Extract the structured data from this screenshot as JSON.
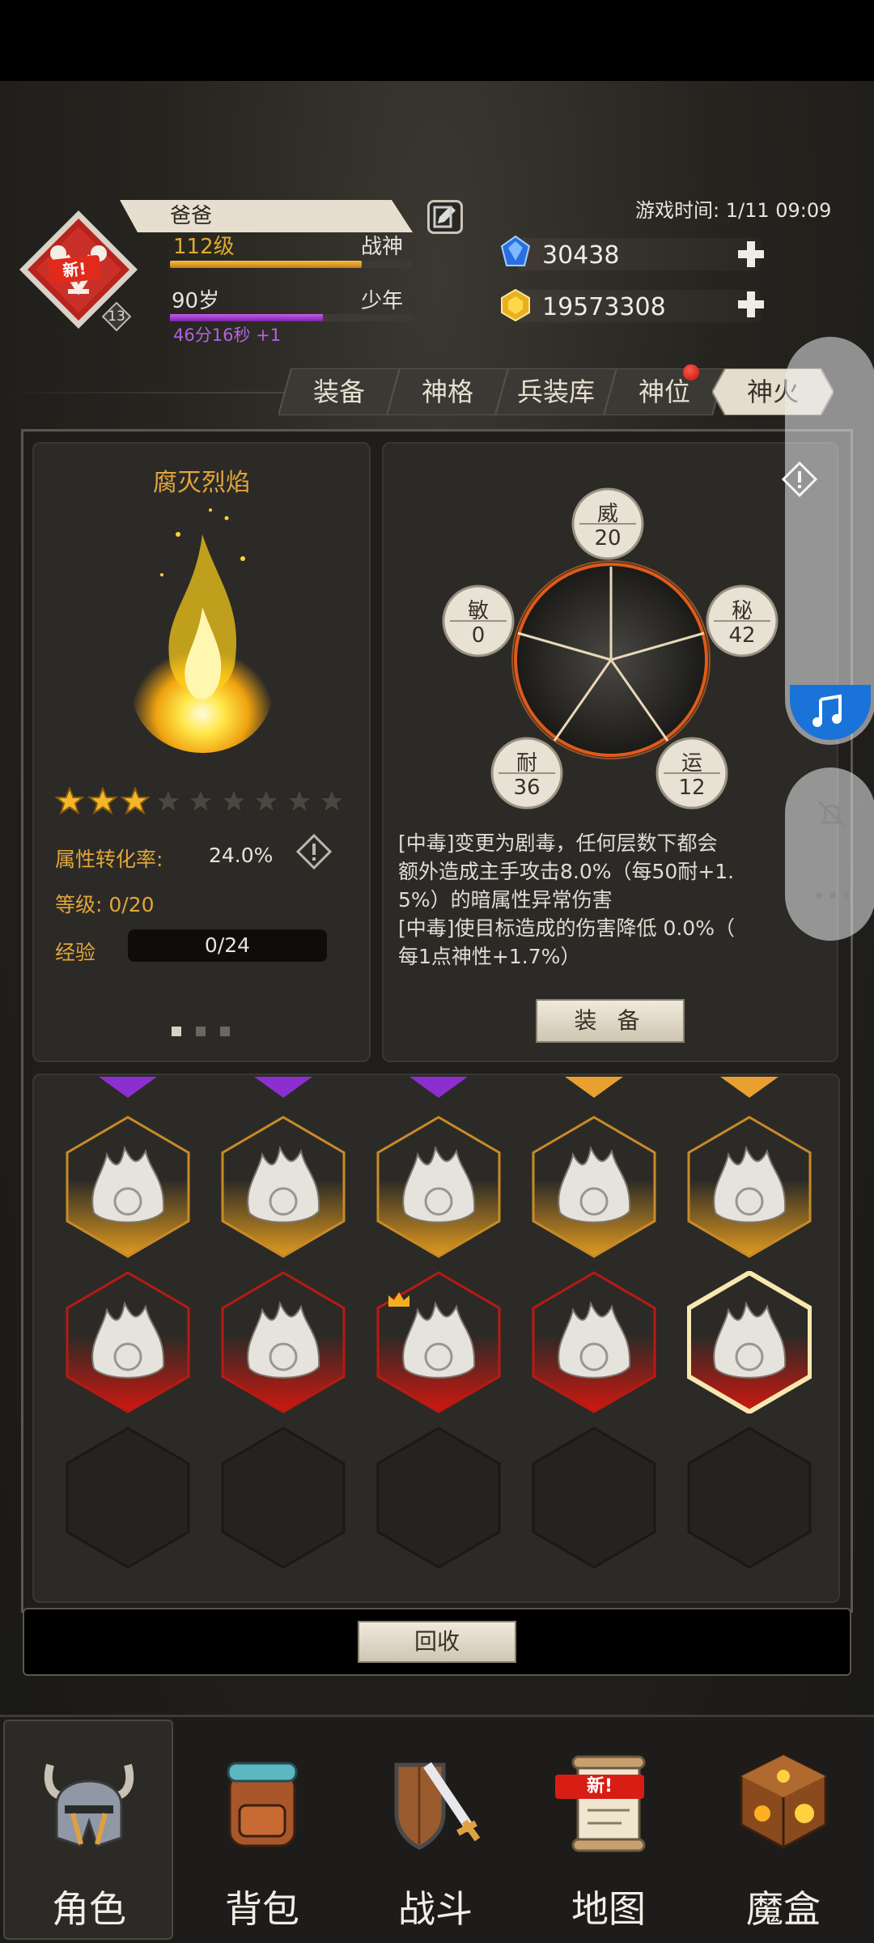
{
  "header": {
    "player_name": "爸爸",
    "level": "112级",
    "title": "战神",
    "level_badge": "13",
    "age": "90岁",
    "age_stage": "少年",
    "timer": "46分16秒 +1",
    "game_time": "游戏时间: 1/11 09:09",
    "exp_progress": 0.79,
    "age_progress": 0.63,
    "new_badge": "新!"
  },
  "currency": {
    "gems": "30438",
    "gold": "19573308"
  },
  "tabs": [
    {
      "label": "装备"
    },
    {
      "label": "神格"
    },
    {
      "label": "兵装库"
    },
    {
      "label": "神位"
    },
    {
      "label": "神火",
      "active": true
    }
  ],
  "fire": {
    "name": "腐灭烈焰",
    "stars_filled": 3,
    "stars_total": 9,
    "conversion_label": "属性转化率:",
    "conversion_value": "24.0%",
    "grade_label": "等级: 0/20",
    "exp_label": "经验",
    "exp_value": "0/24"
  },
  "attributes": [
    {
      "label": "威",
      "value": "20"
    },
    {
      "label": "秘",
      "value": "42"
    },
    {
      "label": "运",
      "value": "12"
    },
    {
      "label": "耐",
      "value": "36"
    },
    {
      "label": "敏",
      "value": "0"
    }
  ],
  "description": {
    "line1": "[中毒]变更为剧毒，任何层数下都会",
    "line2": "额外造成主手攻击8.0%（每50耐+1.",
    "line3": "5%）的暗属性异常伤害",
    "line4": "[中毒]使目标造成的伤害降低 0.0%（",
    "line5": "每1点神性+1.7%）"
  },
  "equip_button": "装 备",
  "recycle_button": "回收",
  "nav": [
    {
      "label": "角色",
      "active": true
    },
    {
      "label": "背包"
    },
    {
      "label": "战斗"
    },
    {
      "label": "地图",
      "badge": "新!"
    },
    {
      "label": "魔盒"
    }
  ],
  "colors": {
    "gold_text": "#e0a63a",
    "purple_rarity": "#8b2fd0",
    "orange_rarity": "#e8a030",
    "red_rarity": "#c81a10"
  }
}
